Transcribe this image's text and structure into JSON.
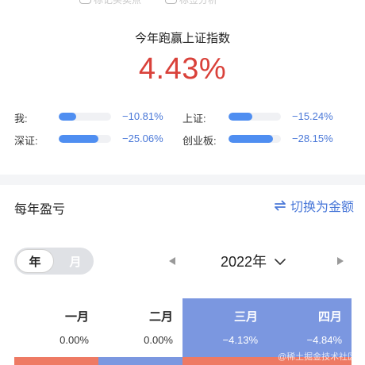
{
  "top_options": [
    {
      "label": "标记买卖点"
    },
    {
      "label": "标签分析"
    }
  ],
  "headline": "今年跑赢上证指数",
  "outperform_pct": "4.43%",
  "comparisons": [
    {
      "label": "我:",
      "value": "−10.81%",
      "fill": 0.33
    },
    {
      "label": "上证:",
      "value": "−15.24%",
      "fill": 0.46
    },
    {
      "label": "深证:",
      "value": "−25.06%",
      "fill": 0.75
    },
    {
      "label": "创业板:",
      "value": "−28.15%",
      "fill": 0.85
    }
  ],
  "section": {
    "title": "每年盈亏",
    "switch_label": "切换为金额",
    "switch_icon": "swap-arrows-icon"
  },
  "period_toggle": {
    "options": [
      "年",
      "月"
    ],
    "selected": "年"
  },
  "year_selector": {
    "value": "2022年",
    "icon": "chevron-down-icon"
  },
  "months": [
    {
      "name": "一月",
      "value": "0.00%",
      "selected": false,
      "bar_color": "#ee7a64"
    },
    {
      "name": "二月",
      "value": "0.00%",
      "selected": false,
      "bar_color": "#7b97e0"
    },
    {
      "name": "三月",
      "value": "−4.13%",
      "selected": true,
      "bar_color": "#ee7a64"
    },
    {
      "name": "四月",
      "value": "−4.84%",
      "selected": true,
      "bar_color": "#ee7a64"
    }
  ],
  "colors": {
    "accent": "#4a78d8",
    "highlight": "#d9413a",
    "selected_column": "#7b97e0"
  },
  "watermark": "@稀土掘金技术社区"
}
